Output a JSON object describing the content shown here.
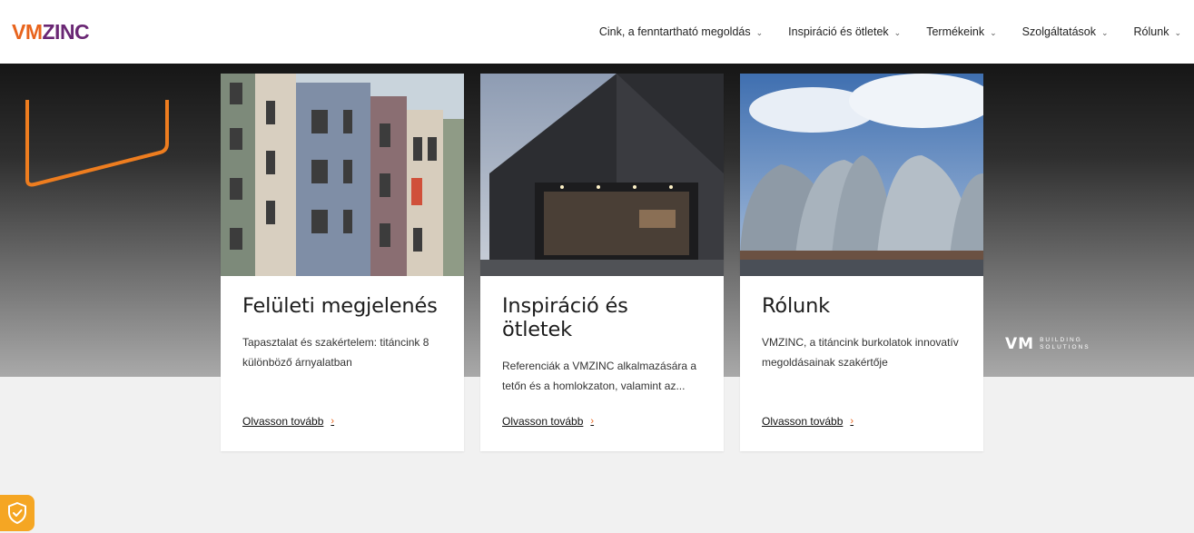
{
  "brand": {
    "logo_vm": "VM",
    "logo_zinc": "ZINC",
    "accent_orange": "#e8641d",
    "accent_purple": "#6a2774"
  },
  "nav": {
    "items": [
      {
        "label": "Cink, a fenntartható megoldás",
        "icon": "chevron-down-icon"
      },
      {
        "label": "Inspiráció és ötletek",
        "icon": "chevron-down-icon"
      },
      {
        "label": "Termékeink",
        "icon": "chevron-down-icon"
      },
      {
        "label": "Szolgáltatások",
        "icon": "chevron-down-icon"
      },
      {
        "label": "Rólunk",
        "icon": "chevron-down-icon"
      }
    ]
  },
  "cards": [
    {
      "title": "Felületi megjelenés",
      "text": "Tapasztalat és szakértelem: titáncink 8 különböző árnyalatban",
      "link": "Olvasson tovább"
    },
    {
      "title": "Inspiráció és ötletek",
      "text": "Referenciák a VMZINC alkalmazására a tetőn és a homlokzaton, valamint az...",
      "link": "Olvasson tovább"
    },
    {
      "title": "Rólunk",
      "text": "VMZINC, a titáncink burkolatok innovatív megoldásainak szakértője",
      "link": "Olvasson tovább"
    }
  ],
  "footer_logo": {
    "vm": "VM",
    "line1": "BUILDING",
    "line2": "SOLUTIONS"
  },
  "cookie_badge": {
    "icon": "shield-check-icon"
  }
}
